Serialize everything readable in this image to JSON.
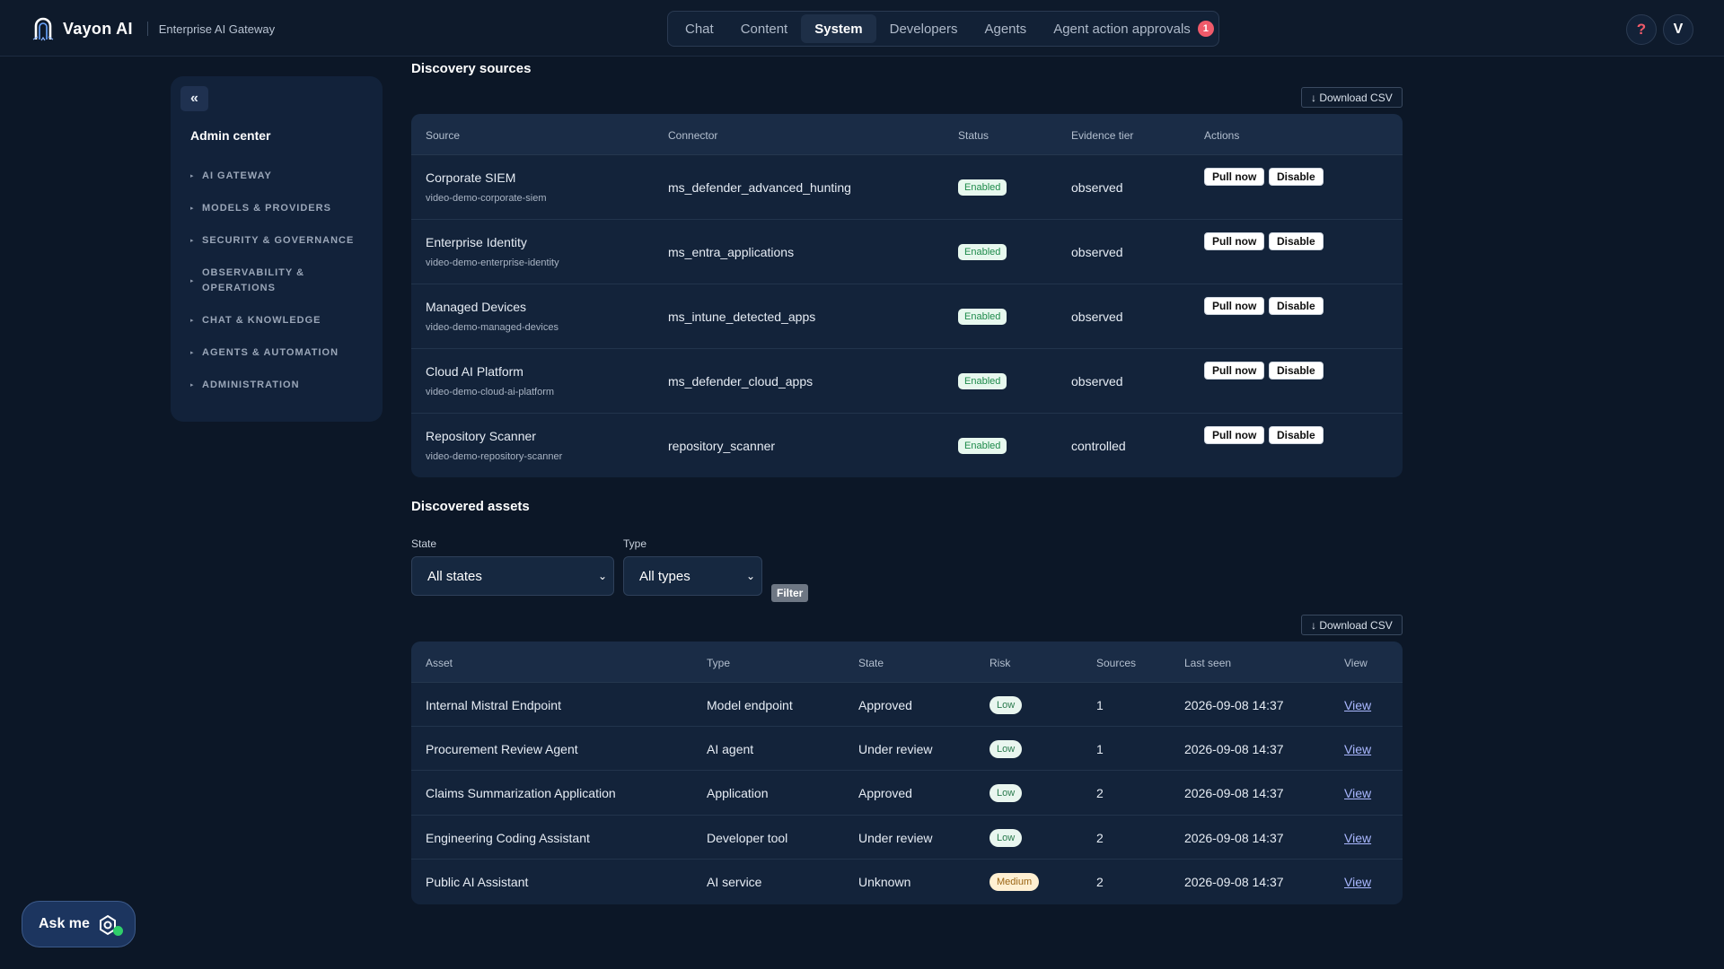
{
  "header": {
    "brand_name": "Vayon AI",
    "brand_subtitle": "Enterprise AI Gateway",
    "nav": [
      "Chat",
      "Content",
      "System",
      "Developers",
      "Agents",
      "Agent action approvals"
    ],
    "active_nav": "System",
    "approvals_badge": "1",
    "help_label": "?",
    "avatar_initial": "V"
  },
  "sidebar": {
    "collapse_label": "«",
    "title": "Admin center",
    "items": [
      "AI GATEWAY",
      "MODELS & PROVIDERS",
      "SECURITY & GOVERNANCE",
      "OBSERVABILITY & OPERATIONS",
      "CHAT & KNOWLEDGE",
      "AGENTS & AUTOMATION",
      "ADMINISTRATION"
    ]
  },
  "discovery": {
    "title": "Discovery sources",
    "download_label": "↓ Download CSV",
    "columns": [
      "Source",
      "Connector",
      "Status",
      "Evidence tier",
      "Actions"
    ],
    "action_labels": {
      "pull": "Pull now",
      "disable": "Disable"
    },
    "rows": [
      {
        "name": "Corporate SIEM",
        "id": "video-demo-corporate-siem",
        "connector": "ms_defender_advanced_hunting",
        "status": "Enabled",
        "tier": "observed"
      },
      {
        "name": "Enterprise Identity",
        "id": "video-demo-enterprise-identity",
        "connector": "ms_entra_applications",
        "status": "Enabled",
        "tier": "observed"
      },
      {
        "name": "Managed Devices",
        "id": "video-demo-managed-devices",
        "connector": "ms_intune_detected_apps",
        "status": "Enabled",
        "tier": "observed"
      },
      {
        "name": "Cloud AI Platform",
        "id": "video-demo-cloud-ai-platform",
        "connector": "ms_defender_cloud_apps",
        "status": "Enabled",
        "tier": "observed"
      },
      {
        "name": "Repository Scanner",
        "id": "video-demo-repository-scanner",
        "connector": "repository_scanner",
        "status": "Enabled",
        "tier": "controlled"
      }
    ]
  },
  "assets": {
    "title": "Discovered assets",
    "state_label": "State",
    "state_value": "All states",
    "type_label": "Type",
    "type_value": "All types",
    "filter_label": "Filter",
    "download_label": "↓ Download CSV",
    "columns": [
      "Asset",
      "Type",
      "State",
      "Risk",
      "Sources",
      "Last seen",
      "View"
    ],
    "view_label": "View",
    "rows": [
      {
        "asset": "Internal Mistral Endpoint",
        "type": "Model endpoint",
        "state": "Approved",
        "risk": "Low",
        "sources": "1",
        "last_seen": "2026-09-08 14:37"
      },
      {
        "asset": "Procurement Review Agent",
        "type": "AI agent",
        "state": "Under review",
        "risk": "Low",
        "sources": "1",
        "last_seen": "2026-09-08 14:37"
      },
      {
        "asset": "Claims Summarization Application",
        "type": "Application",
        "state": "Approved",
        "risk": "Low",
        "sources": "2",
        "last_seen": "2026-09-08 14:37"
      },
      {
        "asset": "Engineering Coding Assistant",
        "type": "Developer tool",
        "state": "Under review",
        "risk": "Low",
        "sources": "2",
        "last_seen": "2026-09-08 14:37"
      },
      {
        "asset": "Public AI Assistant",
        "type": "AI service",
        "state": "Unknown",
        "risk": "Medium",
        "sources": "2",
        "last_seen": "2026-09-08 14:37"
      }
    ]
  },
  "askme": {
    "label": "Ask me"
  }
}
